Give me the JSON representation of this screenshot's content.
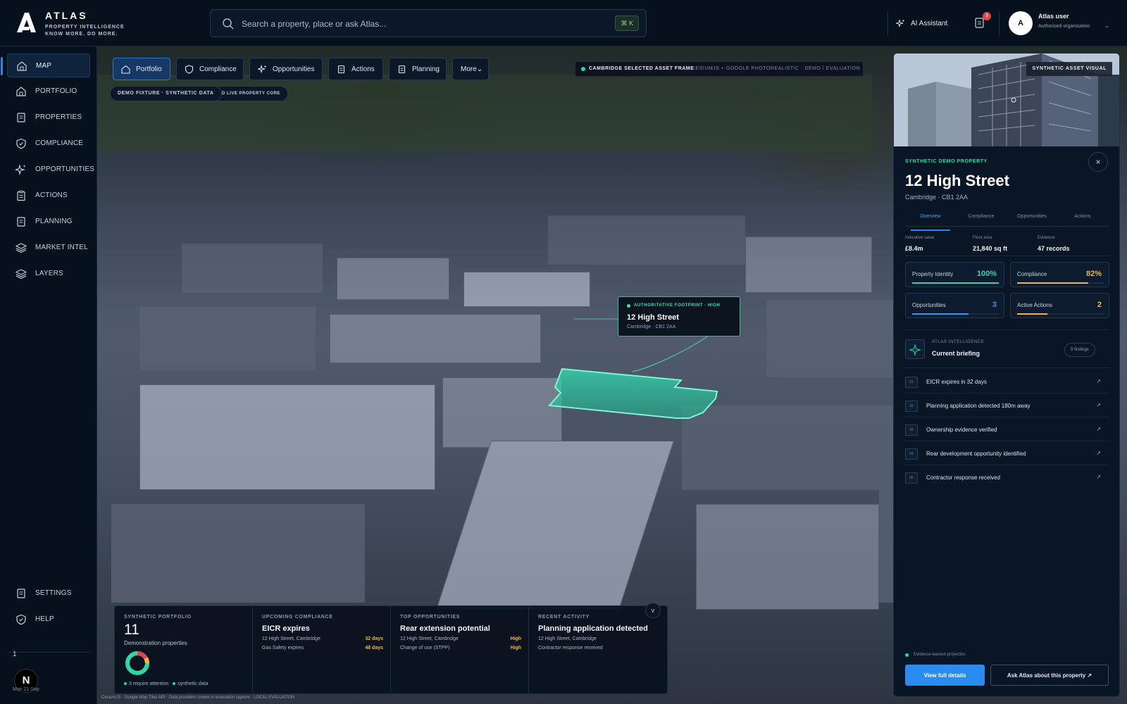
{
  "app": {
    "name": "ATLAS",
    "tagline_line1": "PROPERTY INTELLIGENCE",
    "tagline_line2": "KNOW MORE. DO MORE."
  },
  "header": {
    "search_placeholder": "Search a property, place or ask Atlas...",
    "search_shortcut": "⌘ K",
    "ai_assistant_label": "AI Assistant",
    "notification_count": "3",
    "user_initial": "A",
    "user_name": "Atlas user",
    "user_org": "Authorised organisation"
  },
  "sidebar": {
    "items": [
      {
        "label": "MAP",
        "icon": "map-icon",
        "active": true
      },
      {
        "label": "PORTFOLIO",
        "icon": "building-icon"
      },
      {
        "label": "PROPERTIES",
        "icon": "document-icon"
      },
      {
        "label": "COMPLIANCE",
        "icon": "shield-icon"
      },
      {
        "label": "OPPORTUNITIES",
        "icon": "sparkle-icon"
      },
      {
        "label": "ACTIONS",
        "icon": "clipboard-icon"
      },
      {
        "label": "PLANNING",
        "icon": "document-icon"
      },
      {
        "label": "MARKET INTEL",
        "icon": "layers-icon"
      },
      {
        "label": "LAYERS",
        "icon": "layers-icon"
      }
    ],
    "bottom_items": [
      {
        "label": "SETTINGS",
        "icon": "gear-icon"
      },
      {
        "label": "HELP",
        "icon": "shield-icon"
      }
    ],
    "footer_number": "1",
    "footer_logo_letter": "N",
    "footer_date": "Mon 21 Sep"
  },
  "map": {
    "tabs": [
      {
        "label": "Portfolio",
        "icon": "building-icon",
        "active": true
      },
      {
        "label": "Compliance",
        "icon": "shield-icon"
      },
      {
        "label": "Opportunities",
        "icon": "sparkle-icon"
      },
      {
        "label": "Actions",
        "icon": "clipboard-icon"
      },
      {
        "label": "Planning",
        "icon": "document-icon"
      },
      {
        "label": "More⌄",
        "icon": ""
      }
    ],
    "demo_badge": "DEMO FIXTURE · SYNTHETIC DATA",
    "live_badge": "D LIVE PROPERTY CORE",
    "frame_strong": "CAMBRIDGE SELECTED ASSET FRAME",
    "frame_light": "CESIUMJS + GOOGLE PHOTOREALISTIC · DEMO / EVALUATION",
    "callout_kicker": "AUTHORITATIVE FOOTPRINT · HIGH",
    "callout_title": "12 High Street",
    "callout_sub": "Cambridge · CB1 2AA",
    "footer_attribution": "CesiumJS · Google Map Tiles API · Data providers shown in evaluation capture · LOCAL EVALUATION",
    "accent": "#2fd6a8"
  },
  "strip": {
    "portfolio": {
      "kicker": "SYNTHETIC PORTFOLIO",
      "count": "11",
      "sub": "Demonstration properties",
      "foot_a": "3 require attention",
      "foot_b": "synthetic data"
    },
    "compliance": {
      "kicker": "UPCOMING COMPLIANCE",
      "title": "EICR expires",
      "rows": [
        {
          "text": "12 High Street, Cambridge",
          "value": "32 days"
        },
        {
          "text": "Gas Safety expires",
          "value": "48 days"
        }
      ]
    },
    "opportunities": {
      "kicker": "TOP OPPORTUNITIES",
      "title": "Rear extension potential",
      "rows": [
        {
          "text": "12 High Street, Cambridge",
          "value": "High"
        },
        {
          "text": "Change of use (STPP)",
          "value": "High"
        }
      ]
    },
    "activity": {
      "kicker": "RECENT ACTIVITY",
      "title": "Planning application detected",
      "rows": [
        {
          "text": "12 High Street, Cambridge",
          "value": ""
        },
        {
          "text": "Contractor response received",
          "value": ""
        }
      ]
    },
    "collapse_label": "v"
  },
  "panel": {
    "hero_tag": "SYNTHETIC ASSET VISUAL",
    "kicker": "SYNTHETIC DEMO PROPERTY",
    "title": "12 High Street",
    "subtitle": "Cambridge · CB1 2AA",
    "close": "×",
    "tabs": [
      "Overview",
      "Compliance",
      "Opportunities",
      "Actions"
    ],
    "stats": [
      {
        "label": "Indicative value",
        "value": "£8.4m"
      },
      {
        "label": "Floor area",
        "value": "21,840 sq ft"
      },
      {
        "label": "Evidence",
        "value": "47 records"
      }
    ],
    "scores": [
      {
        "label": "Property Identity",
        "value": "100%",
        "fraction": 1.0,
        "color": "#2fd6a8"
      },
      {
        "label": "Compliance",
        "value": "82%",
        "fraction": 0.82,
        "color": "#f3b63a"
      },
      {
        "label": "Opportunities",
        "value": "3",
        "fraction": 0.65,
        "color": "#3d93ee"
      },
      {
        "label": "Active Actions",
        "value": "2",
        "fraction": 0.35,
        "color": "#f3b63a"
      }
    ],
    "intel_kicker": "ATLAS INTELLIGENCE",
    "intel_title": "Current briefing",
    "intel_badge": "5 findings",
    "findings": [
      {
        "num": "01",
        "text": "EICR expires in 32 days"
      },
      {
        "num": "02",
        "text": "Planning application detected 180m away"
      },
      {
        "num": "03",
        "text": "Ownership evidence verified"
      },
      {
        "num": "04",
        "text": "Rear development opportunity identified"
      },
      {
        "num": "05",
        "text": "Contractor response received"
      }
    ],
    "evidence_note": "Evidence-backed projection",
    "primary_button": "View full details",
    "secondary_button": "Ask Atlas about this property ↗"
  }
}
